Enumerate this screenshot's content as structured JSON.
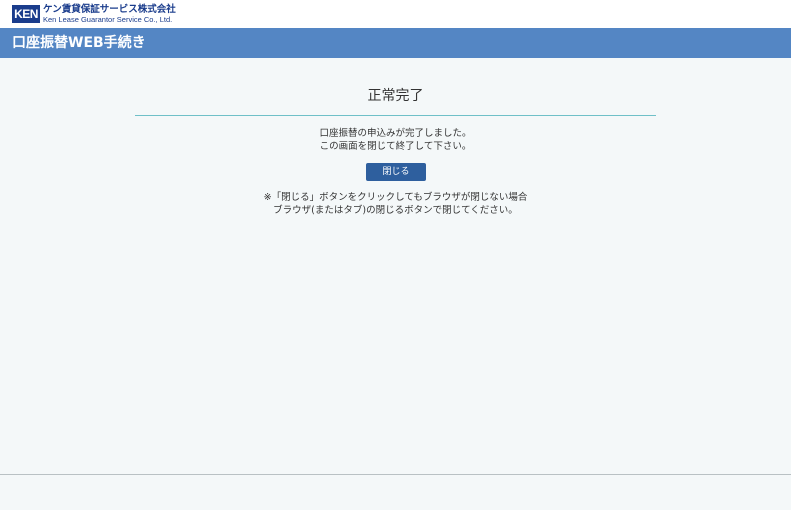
{
  "logo": {
    "mark": "KEN",
    "company_jp": "ケン賃貸保証サービス株式会社",
    "company_en": "Ken Lease Guarantor Service Co., Ltd."
  },
  "header": {
    "title": "口座振替WEB手続き"
  },
  "main": {
    "title": "正常完了",
    "message_lines": [
      "口座振替の申込みが完了しました。",
      "この画面を閉じて終了して下さい。"
    ],
    "close_button_label": "閉じる",
    "note_lines": [
      "※「閉じる」ボタンをクリックしてもブラウザが閉じない場合",
      "ブラウザ(またはタブ)の閉じるボタンで閉じてください。"
    ]
  },
  "colors": {
    "header_bg": "#5486c4",
    "button_bg": "#2e5f9e",
    "divider": "#6fc0c8",
    "logo_blue": "#1a3c8c"
  }
}
